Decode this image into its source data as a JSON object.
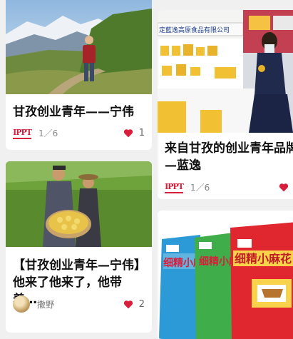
{
  "feed": {
    "cards": [
      {
        "title_lines": [
          "甘孜创业青年——宁伟"
        ],
        "photo_count": "1／6",
        "likes": "1"
      },
      {
        "title_lines": [
          "来自甘孜的创业青年品牌",
          "—蓝逸"
        ],
        "photo_count": "1／6",
        "sign_text": "定藍逸高原食品有限公司",
        "likes": "1"
      },
      {
        "title_lines": [
          "【甘孜创业青年—宁伟】",
          "他来了他来了，他带着…"
        ],
        "author": "撒野",
        "likes": "2"
      },
      {
        "package_text": [
          "细精小麻花",
          "细精小麻花",
          "细精小麻花"
        ]
      }
    ],
    "stamp_text": "IPPT",
    "colors": {
      "accent": "#d81e3a",
      "card_bg": "#ffffff",
      "feed_bg": "#f0f0f0"
    }
  }
}
